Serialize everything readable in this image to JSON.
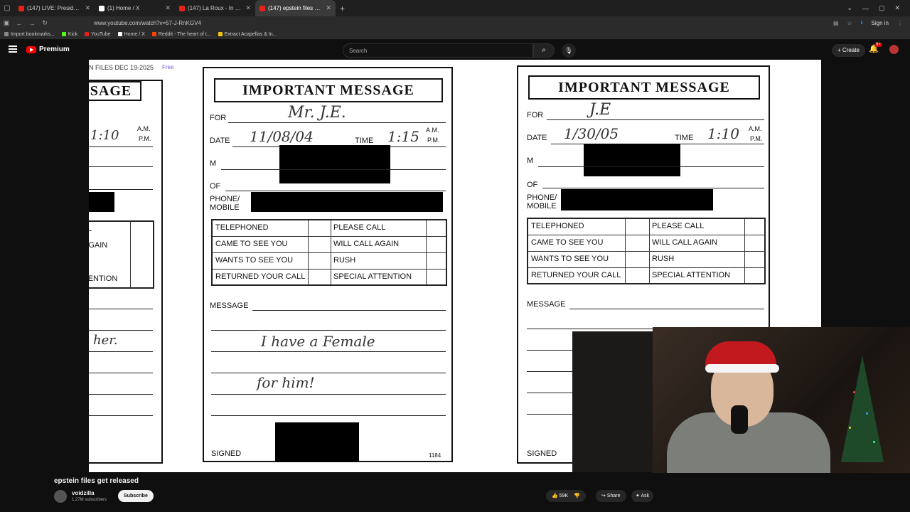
{
  "browser": {
    "tabs": [
      {
        "title": "(147) LIVE: President Trump ma",
        "color": "#e62117",
        "active": false
      },
      {
        "title": "(1) Home / X",
        "color": "#ffffff",
        "active": false
      },
      {
        "title": "(147) La Roux - In For The Kill (",
        "color": "#e62117",
        "active": false
      },
      {
        "title": "(147) epstein files get relea",
        "color": "#e62117",
        "active": true
      }
    ],
    "new_tab": "+",
    "url": "www.youtube.com/watch?v=57-J-RnKGV4",
    "sign_in": "Sign in",
    "bookmarks": [
      {
        "label": "Import bookmarks...",
        "color": "#8a8a8a"
      },
      {
        "label": "Kick",
        "color": "#53fc18"
      },
      {
        "label": "YouTube",
        "color": "#e62117"
      },
      {
        "label": "Home / X",
        "color": "#ffffff"
      },
      {
        "label": "Reddit - The heart of t...",
        "color": "#ff4500"
      },
      {
        "label": "Extract Acapellas & In...",
        "color": "#f5c518"
      }
    ]
  },
  "youtube": {
    "logo": "Premium",
    "search_placeholder": "Search",
    "create_label": "Create",
    "notif_count": "9+"
  },
  "video": {
    "overlay_label": "N FILES DEC 19-2025",
    "free_label": "Free",
    "doc_left_partial": {
      "title": "SAGE",
      "time": "1:10",
      "am": "A.M.",
      "pm": "P.M.",
      "rows": [
        "LL",
        "AGAIN",
        "",
        "TENTION"
      ],
      "hand": "her."
    },
    "doc_center": {
      "title": "IMPORTANT MESSAGE",
      "for_label": "FOR",
      "for_value": "Mr. J.E.",
      "date_label": "DATE",
      "date_value": "11/08/04",
      "time_label": "TIME",
      "time_value": "1:15",
      "am": "A.M.",
      "pm": "P.M.",
      "m_label": "M",
      "of_label": "OF",
      "phone_label": "PHONE/",
      "mobile_label": "MOBILE",
      "grid_left": [
        "TELEPHONED",
        "CAME TO SEE YOU",
        "WANTS TO SEE YOU",
        "RETURNED YOUR CALL"
      ],
      "grid_right": [
        "PLEASE CALL",
        "WILL CALL AGAIN",
        "RUSH",
        "SPECIAL ATTENTION"
      ],
      "message_label": "MESSAGE",
      "message_line1": "I have a Female",
      "message_line2": "for him!",
      "signed_label": "SIGNED",
      "page_no": "1184"
    },
    "doc_right": {
      "title": "IMPORTANT MESSAGE",
      "for_label": "FOR",
      "for_value": "J.E",
      "date_label": "DATE",
      "date_value": "1/30/05",
      "time_label": "TIME",
      "time_value": "1:10",
      "am": "A.M.",
      "pm": "P.M.",
      "m_label": "M",
      "of_label": "OF",
      "phone_label": "PHONE/",
      "mobile_label": "MOBILE",
      "grid_left": [
        "TELEPHONED",
        "CAME TO SEE YOU",
        "WANTS TO SEE YOU",
        "RETURNED YOUR CALL"
      ],
      "grid_right": [
        "PLEASE CALL",
        "WILL CALL AGAIN",
        "RUSH",
        "SPECIAL ATTENTION"
      ],
      "message_label": "MESSAGE",
      "signed_label": "SIGNED"
    }
  },
  "below": {
    "title": "epstein files get released",
    "channel": "voidzilla",
    "subscribers": "1.27M subscribers",
    "subscribe_label": "Subscribe",
    "likes": "59K",
    "share_label": "Share",
    "ask_label": "Ask"
  }
}
